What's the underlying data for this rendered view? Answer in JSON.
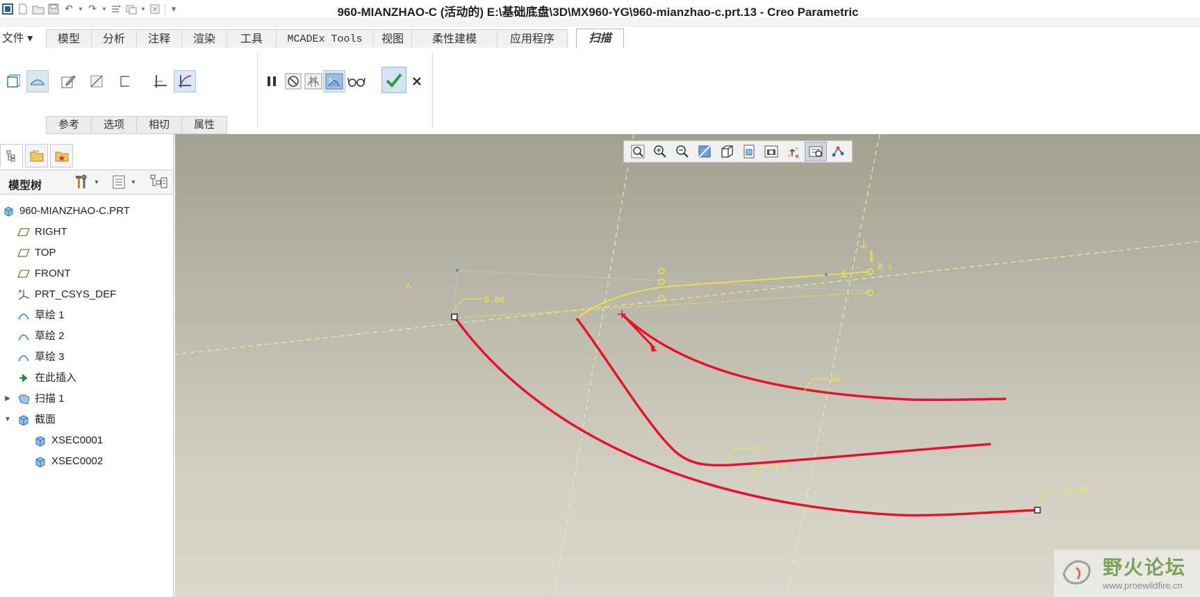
{
  "window": {
    "title": "960-MIANZHAO-C (活动的) E:\\基础底盘\\3D\\MX960-YG\\960-mianzhao-c.prt.13 - Creo Parametric"
  },
  "ribbon_tabs": [
    {
      "label": "文件 ▾"
    },
    {
      "label": "模型"
    },
    {
      "label": "分析"
    },
    {
      "label": "注释"
    },
    {
      "label": "渲染"
    },
    {
      "label": "工具"
    },
    {
      "label": "MCADEx Tools"
    },
    {
      "label": "视图"
    },
    {
      "label": "柔性建模"
    },
    {
      "label": "应用程序"
    },
    {
      "label": "扫描"
    }
  ],
  "sweep_subtabs": [
    {
      "label": "参考"
    },
    {
      "label": "选项"
    },
    {
      "label": "相切"
    },
    {
      "label": "属性"
    }
  ],
  "model_tree": {
    "header": "模型树",
    "root": "960-MIANZHAO-C.PRT",
    "items": [
      {
        "label": "RIGHT",
        "icon": "datum-plane-icon"
      },
      {
        "label": "TOP",
        "icon": "datum-plane-icon"
      },
      {
        "label": "FRONT",
        "icon": "datum-plane-icon"
      },
      {
        "label": "PRT_CSYS_DEF",
        "icon": "csys-icon"
      },
      {
        "label": "草绘 1",
        "icon": "sketch-icon"
      },
      {
        "label": "草绘 2",
        "icon": "sketch-icon"
      },
      {
        "label": "草绘 3",
        "icon": "sketch-icon"
      },
      {
        "label": "在此插入",
        "icon": "insert-here-icon"
      },
      {
        "label": "扫描 1",
        "icon": "sweep-icon"
      },
      {
        "label": "截面",
        "icon": "xsec-folder-icon"
      },
      {
        "label": "XSEC0001",
        "icon": "xsec-icon"
      },
      {
        "label": "XSEC0002",
        "icon": "xsec-icon"
      }
    ]
  },
  "viewport_annotations": {
    "dim_left": "0.00",
    "dim_right": "0.00",
    "trajectory_label_1": "RA",
    "trajectory_label_2": "B 1",
    "trajectory_label_3": "R 2",
    "constraint_label": "B 1"
  },
  "watermark": {
    "site_name": "野火论坛",
    "url": "www.proewildfire.cn"
  },
  "colors": {
    "trajectory": "#e8112d",
    "sketch": "#e8e83a",
    "confirm": "#2a9d3a"
  }
}
